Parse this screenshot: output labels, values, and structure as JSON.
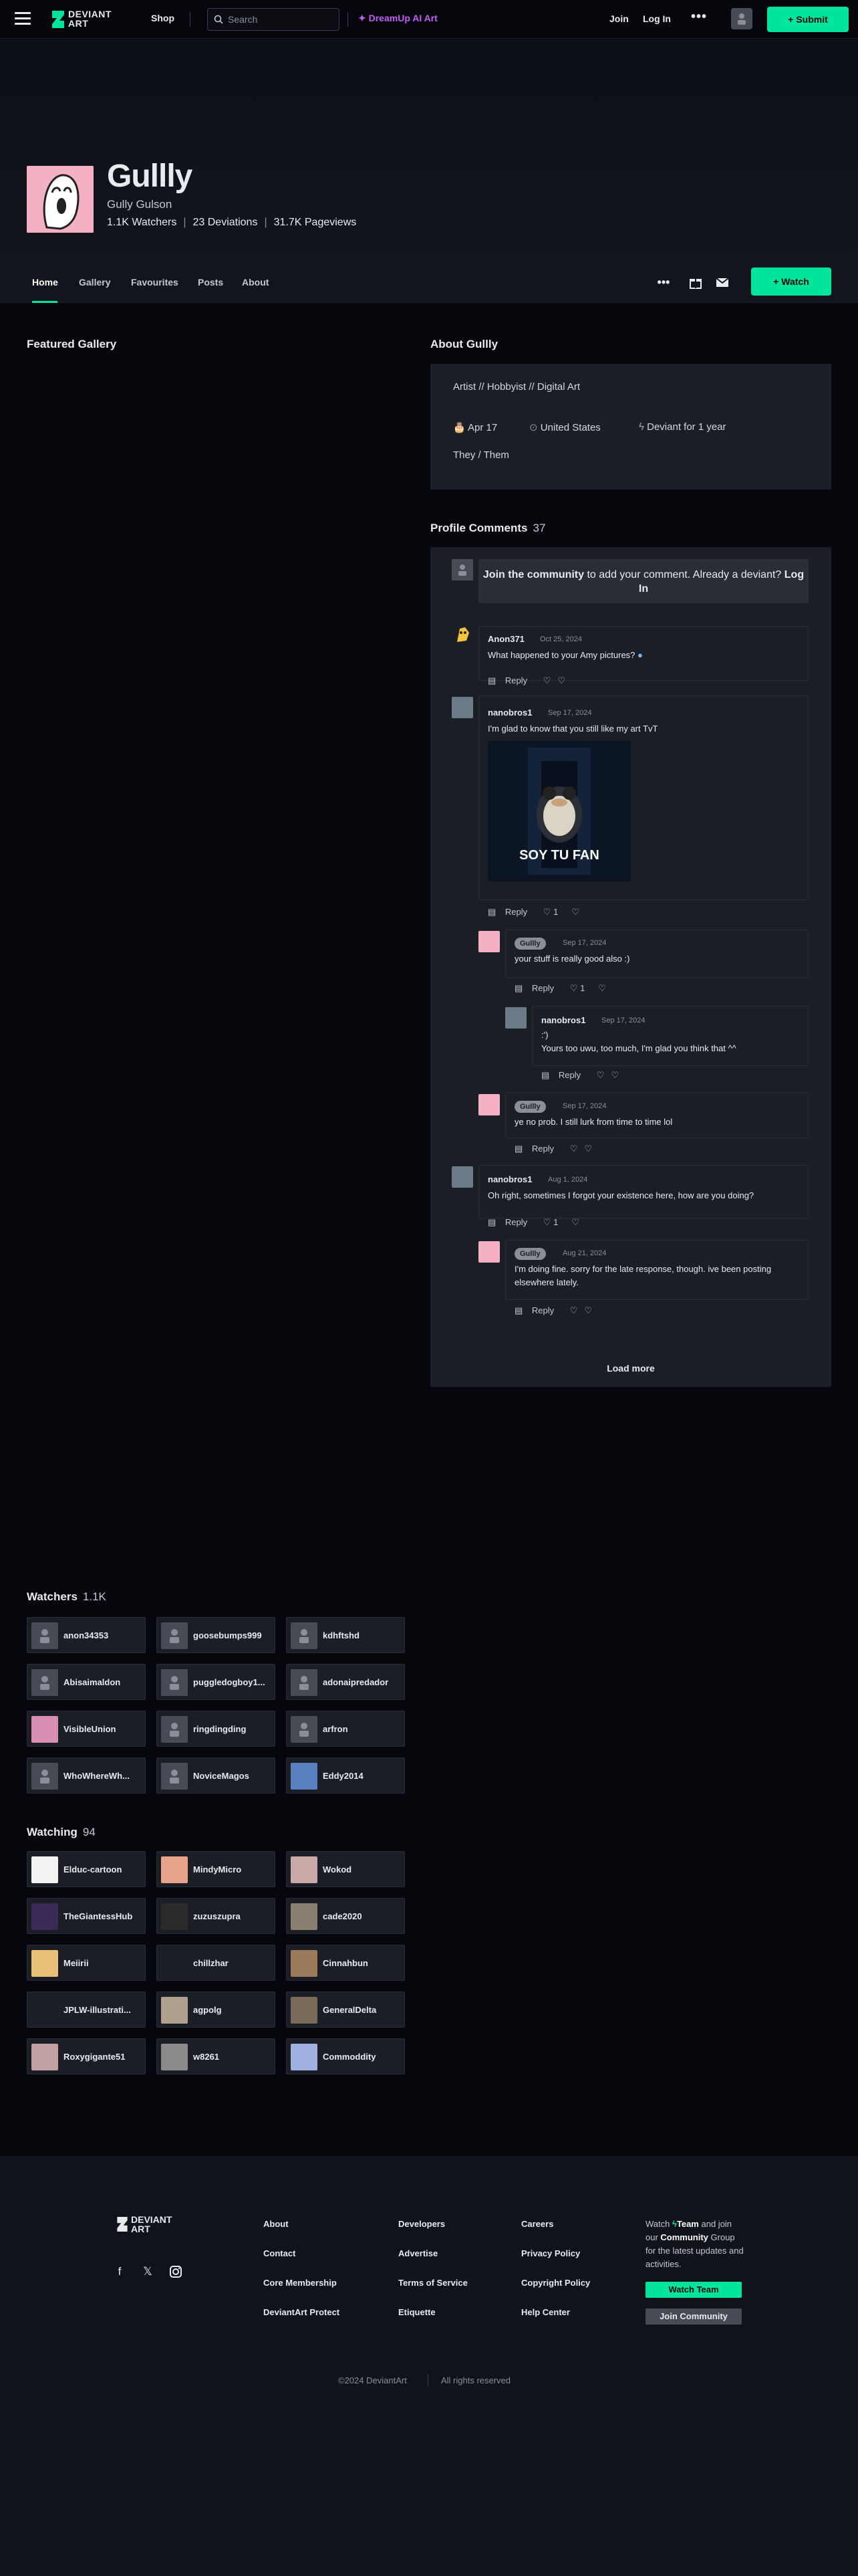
{
  "header": {
    "logo_text_1": "DEVIANT",
    "logo_text_2": "ART",
    "shop": "Shop",
    "search_placeholder": "Search",
    "dreamup": "DreamUp AI Art",
    "join": "Join",
    "login": "Log In",
    "more": "•••",
    "submit": "Submit"
  },
  "profile": {
    "name": "Gullly",
    "real_name": "Gully Gulson",
    "watchers": "1.1K Watchers",
    "deviations": "23 Deviations",
    "pageviews": "31.7K Pageviews"
  },
  "tabs": [
    "Home",
    "Gallery",
    "Favourites",
    "Posts",
    "About"
  ],
  "watch_button": "Watch",
  "featured_title": "Featured Gallery",
  "about": {
    "title": "About Gullly",
    "tags": "Artist  //  Hobbyist  //  Digital Art",
    "birthday": "Apr 17",
    "location": "United States",
    "membership": "Deviant for 1 year",
    "pronouns": "They / Them"
  },
  "comments": {
    "title": "Profile Comments",
    "count": "37",
    "join_bold": "Join the community",
    "join_text": " to add your comment. Already a deviant? ",
    "join_login": "Log In",
    "reply": "Reply",
    "load_more": "Load more",
    "items": [
      {
        "user": "Anon371",
        "date": "Oct 25, 2024",
        "text": "What happened to your Amy pictures? ",
        "likes": ""
      },
      {
        "user": "nanobros1",
        "date": "Sep 17, 2024",
        "text": "I'm glad to know that you still like my art TvT",
        "image_caption": "SOY TU FAN",
        "likes": "1"
      },
      {
        "user": "Gullly",
        "date": "Sep 17, 2024",
        "text": "your stuff is really good also :)",
        "likes": "1"
      },
      {
        "user": "nanobros1",
        "date": "Sep 17, 2024",
        "text": ":')",
        "text2": "Yours too uwu, too much, I'm glad you think that ^^",
        "likes": ""
      },
      {
        "user": "Gullly",
        "date": "Sep 17, 2024",
        "text": "ye no prob. I still lurk from time to time lol",
        "likes": ""
      },
      {
        "user": "nanobros1",
        "date": "Aug 1, 2024",
        "text": "Oh right, sometimes I forgot your existence here, how are you doing?",
        "likes": "1"
      },
      {
        "user": "Gullly",
        "date": "Aug 21, 2024",
        "text": "I'm doing fine. sorry for the late response, though. ive been posting",
        "text2": "elsewhere lately.",
        "likes": ""
      }
    ]
  },
  "watchers": {
    "title": "Watchers",
    "count": "1.1K",
    "items": [
      "anon34353",
      "goosebumps999",
      "kdhftshd",
      "Abisaimaldon",
      "puggledogboy1...",
      "adonaipredador",
      "VisibleUnion",
      "ringdingding",
      "arfron",
      "WhoWhereWh...",
      "NoviceMagos",
      "Eddy2014"
    ]
  },
  "watching": {
    "title": "Watching",
    "count": "94",
    "items": [
      "Elduc-cartoon",
      "MindyMicro",
      "Wokod",
      "TheGiantessHub",
      "zuzuszupra",
      "cade2020",
      "Meiirii",
      "chillzhar",
      "Cinnahbun",
      "JPLW-illustrati...",
      "agpolg",
      "GeneralDelta",
      "Roxygigante51",
      "w8261",
      "Commoddity"
    ]
  },
  "footer": {
    "col1": [
      "About",
      "Contact",
      "Core Membership",
      "DeviantArt Protect"
    ],
    "col2": [
      "Developers",
      "Advertise",
      "Terms of Service",
      "Etiquette"
    ],
    "col3": [
      "Careers",
      "Privacy Policy",
      "Copyright Policy",
      "Help Center"
    ],
    "community_1": "Watch ",
    "community_team": "Team",
    "community_2": " and join our ",
    "community_bold": "Community",
    "community_3": " Group for the latest updates and activities.",
    "btn_team": "Watch Team",
    "btn_join": "Join Community",
    "copyright": "©2024 DeviantArt",
    "rights": "All rights reserved"
  },
  "colors": {
    "accent": "#00e59b",
    "dreamup": "#c45cf5",
    "background": "#06070d",
    "card": "#1b1e25"
  }
}
